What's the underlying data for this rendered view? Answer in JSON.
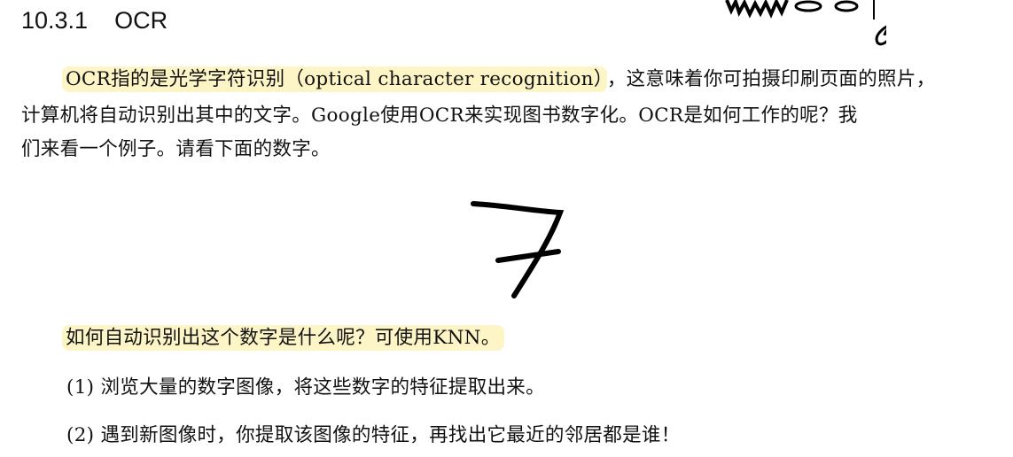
{
  "section": {
    "number": "10.3.1",
    "title": "OCR"
  },
  "paragraph1": {
    "highlighted": "OCR指的是光学字符识别（optical character recognition）",
    "line1_rest": "，这意味着你可拍摄印刷页面的照片，",
    "line2": "计算机将自动识别出其中的文字。Google使用OCR来实现图书数字化。OCR是如何工作的呢？我",
    "line3": "们来看一个例子。请看下面的数字。"
  },
  "figure": {
    "digit": "7"
  },
  "question": "如何自动识别出这个数字是什么呢？可使用KNN。",
  "steps": [
    "(1) 浏览大量的数字图像，将这些数字的特征提取出来。",
    "(2) 遇到新图像时，你提取该图像的特征，再找出它最近的邻居都是谁！"
  ],
  "colors": {
    "highlight": "#fdf5c6"
  }
}
